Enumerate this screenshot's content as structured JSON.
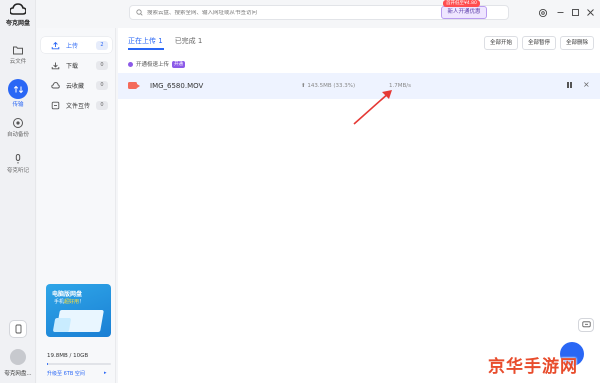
{
  "app": {
    "name": "夸克网盘"
  },
  "rail": {
    "items": [
      {
        "label": "云文件",
        "icon": "folder-icon"
      },
      {
        "label": "传输",
        "icon": "transfer-icon",
        "active": true
      },
      {
        "label": "自动备份",
        "icon": "backup-icon"
      },
      {
        "label": "夸克听记",
        "icon": "mic-icon"
      }
    ],
    "user_name": "夸克网盘..."
  },
  "subnav": {
    "items": [
      {
        "label": "上传",
        "count": "2",
        "icon": "upload-icon",
        "active": true
      },
      {
        "label": "下载",
        "count": "0",
        "icon": "download-icon"
      },
      {
        "label": "云收藏",
        "count": "0",
        "icon": "cloud-collect-icon"
      },
      {
        "label": "文件互传",
        "count": "0",
        "icon": "file-transfer-icon"
      }
    ],
    "promo": {
      "title": "电脑版网盘",
      "sub_prefix": "手机",
      "sub_highlight": "超好用",
      "sub_suffix": "！"
    },
    "storage": {
      "text": "19.8MB / 10GB",
      "used_fraction": 0.02,
      "upgrade": "升级至 6TB 空间",
      "upgrade_arrow": "▸"
    }
  },
  "topbar": {
    "search_placeholder": "搜索云盘、搜索全网、输入网址或从书签访问",
    "vip_tag": "首开低至¥4.80",
    "vip_button": "新人开通优惠"
  },
  "main": {
    "tabs": [
      {
        "label": "正在上传 1",
        "active": true
      },
      {
        "label": "已完成 1"
      }
    ],
    "actions": {
      "start_all": "全部开始",
      "pause_all": "全部暂停",
      "delete_all": "全部删除"
    },
    "speedup": {
      "text": "开通极速上传",
      "tag": "开通"
    },
    "row": {
      "file_name": "IMG_6580.MOV",
      "progress": "143.5MB (33.3%)",
      "progress_percent": 33.3,
      "speed": "1.7MB/s"
    }
  },
  "watermark": "京华手游网",
  "colors": {
    "accent": "#2a67f5",
    "row_bg": "#eef3ff",
    "arrow": "#e53935",
    "vip": "#8c5ae8"
  }
}
